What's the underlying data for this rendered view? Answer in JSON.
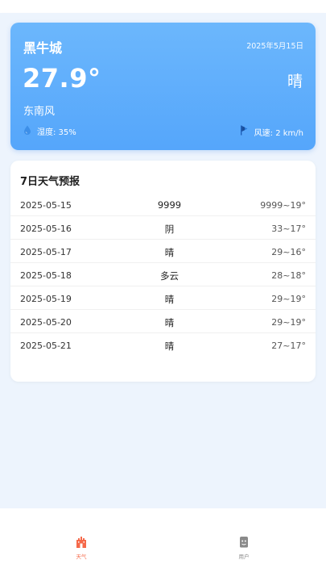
{
  "weather": {
    "city": "黑牛城",
    "date": "2025年5月15日",
    "temperature": "27.9°",
    "condition": "晴",
    "wind_direction": "东南风",
    "humidity": "湿度: 35%",
    "wind_speed": "风速: 2 km/h",
    "humidity_icon": "water-drop-icon",
    "wind_icon": "wind-flag-icon"
  },
  "forecast": {
    "title": "7日天气预报",
    "days": [
      {
        "date": "2025-05-15",
        "condition": "9999",
        "range": "9999~19°"
      },
      {
        "date": "2025-05-16",
        "condition": "阴",
        "range": "33~17°"
      },
      {
        "date": "2025-05-17",
        "condition": "晴",
        "range": "29~16°"
      },
      {
        "date": "2025-05-18",
        "condition": "多云",
        "range": "28~18°"
      },
      {
        "date": "2025-05-19",
        "condition": "晴",
        "range": "29~19°"
      },
      {
        "date": "2025-05-20",
        "condition": "晴",
        "range": "29~19°"
      },
      {
        "date": "2025-05-21",
        "condition": "晴",
        "range": "27~17°"
      }
    ]
  },
  "tabs": [
    {
      "label": "天气",
      "icon": "castle-icon",
      "active": true
    },
    {
      "label": "用户",
      "icon": "user-icon",
      "active": false
    }
  ],
  "colors": {
    "card_gradient_top": "#6cb7fc",
    "card_gradient_bottom": "#55a6fb",
    "active_tab": "#f5694a",
    "inactive_tab": "#8a8a8a",
    "page_background": "#edf4fd"
  }
}
